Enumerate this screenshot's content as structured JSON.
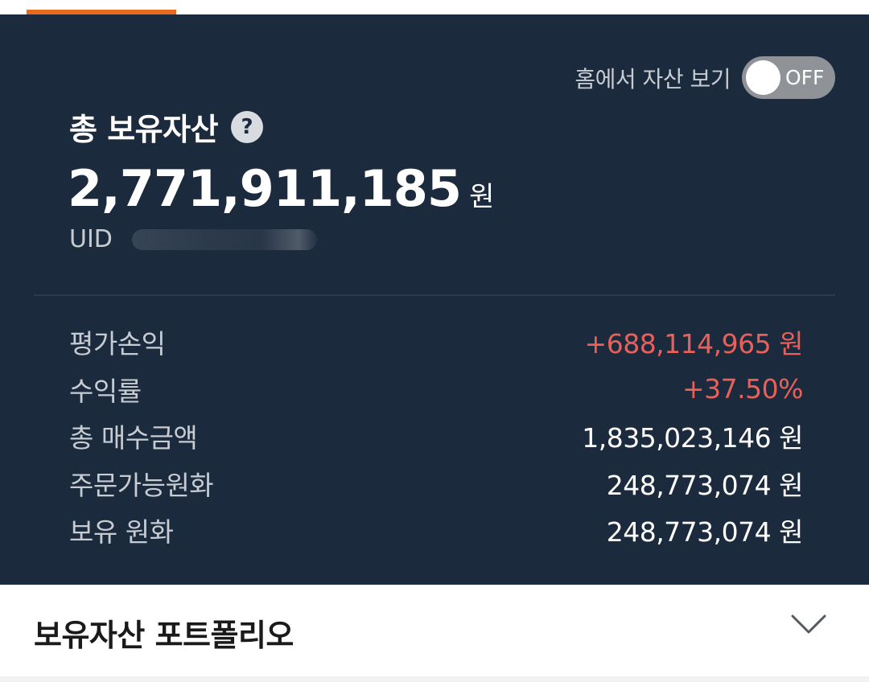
{
  "home_toggle": {
    "label": "홈에서 자산 보기",
    "state_text": "OFF"
  },
  "total": {
    "title": "총 보유자산",
    "help_icon": "?",
    "value": "2,771,911,185",
    "unit": "원",
    "uid_label": "UID"
  },
  "stats": [
    {
      "label": "평가손익",
      "value": "+688,114,965 원"
    },
    {
      "label": "수익률",
      "value": "+37.50%"
    },
    {
      "label": "총 매수금액",
      "value": "1,835,023,146 원"
    },
    {
      "label": "주문가능원화",
      "value": "248,773,074 원"
    },
    {
      "label": "보유 원화",
      "value": "248,773,074 원"
    }
  ],
  "portfolio": {
    "title": "보유자산 포트폴리오",
    "icon": "chevron-down-icon"
  },
  "colors": {
    "panel_bg": "#1c2a3d",
    "accent_tab": "#e86a1e",
    "positive": "#e7615a"
  }
}
